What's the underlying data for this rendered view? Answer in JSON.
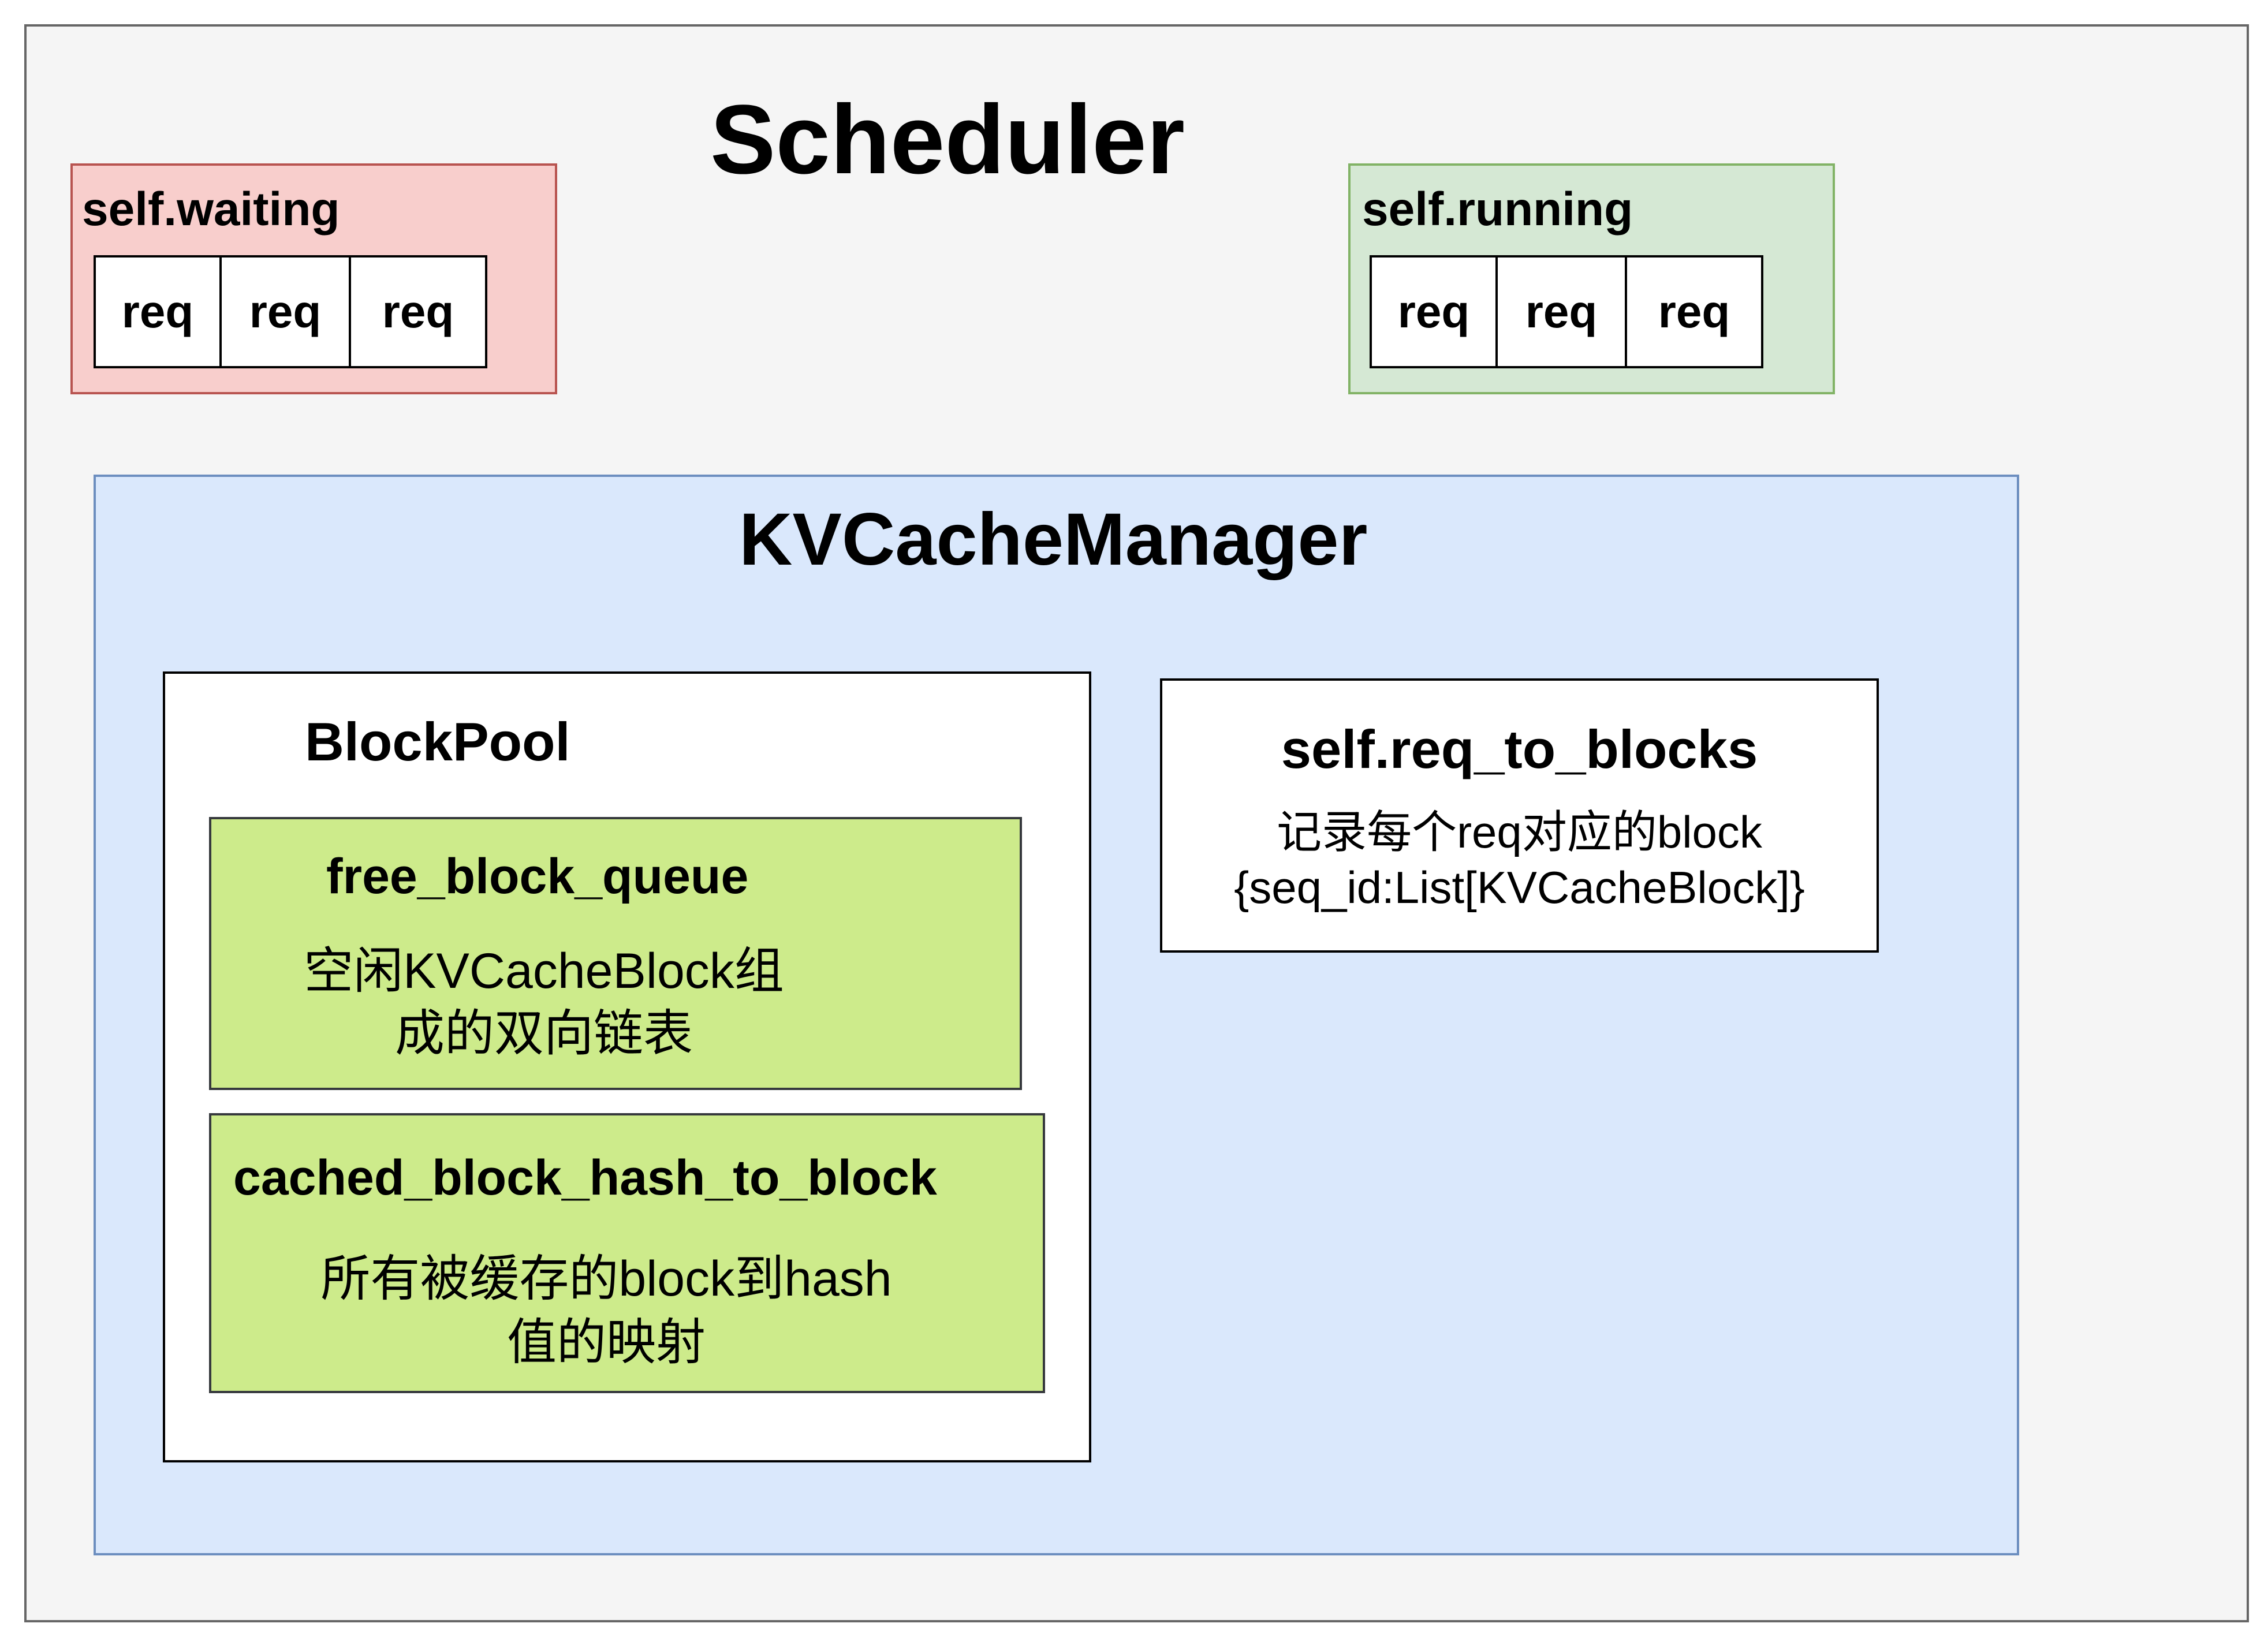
{
  "scheduler": {
    "title": "Scheduler",
    "waiting": {
      "label": "self.waiting",
      "items": [
        "req",
        "req",
        "req"
      ]
    },
    "running": {
      "label": "self.running",
      "items": [
        "req",
        "req",
        "req"
      ]
    }
  },
  "kv_cache_manager": {
    "title": "KVCacheManager",
    "block_pool": {
      "title": "BlockPool",
      "free_block_queue": {
        "title": "free_block_queue",
        "desc_line1": "空闲KVCacheBlock组",
        "desc_line2": "成的双向链表"
      },
      "cached_block_hash_to_block": {
        "title": "cached_block_hash_to_block",
        "desc_line1": "所有被缓存的block到hash",
        "desc_line2": "值的映射"
      }
    },
    "req_to_blocks": {
      "title": "self.req_to_blocks",
      "desc_line1": "记录每个req对应的block",
      "desc_line2": "{seq_id:List[KVCacheBlock]}"
    }
  },
  "colors": {
    "scheduler_bg": "#f5f5f5",
    "waiting_bg": "#f8cecc",
    "waiting_border": "#b85450",
    "running_bg": "#d5e8d4",
    "running_border": "#82b366",
    "kvcm_bg": "#dae8fc",
    "kvcm_border": "#6c8ebf",
    "block_bg": "#cdeb8b"
  }
}
